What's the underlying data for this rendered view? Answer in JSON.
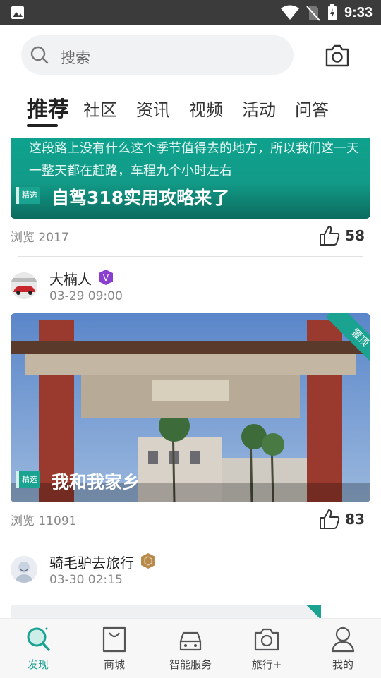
{
  "status_bar": {
    "time": "9:33"
  },
  "search": {
    "placeholder": "搜索"
  },
  "tabs": [
    {
      "label": "推荐",
      "active": true
    },
    {
      "label": "社区"
    },
    {
      "label": "资讯"
    },
    {
      "label": "视频"
    },
    {
      "label": "活动"
    },
    {
      "label": "问答"
    }
  ],
  "feed": [
    {
      "description": "这段路上没有什么这个季节值得去的地方，所以我们这一天一整天都在赶路，车程九个小时左右",
      "badge": "精选",
      "title": "自驾318实用攻略来了",
      "views": "浏览 2017",
      "likes": "58"
    },
    {
      "author": "大楠人",
      "date": "03-29 09:00",
      "pinned": "置顶",
      "badge": "精选",
      "title": "我和我家乡",
      "views": "浏览 11091",
      "likes": "83"
    },
    {
      "author": "骑毛驴去旅行",
      "date": "03-30 02:15"
    }
  ],
  "bottom_nav": [
    {
      "label": "发现",
      "icon": "discover-icon",
      "active": true
    },
    {
      "label": "商城",
      "icon": "shop-icon"
    },
    {
      "label": "智能服务",
      "icon": "car-service-icon"
    },
    {
      "label": "旅行+",
      "icon": "camera-icon"
    },
    {
      "label": "我的",
      "icon": "profile-icon"
    }
  ],
  "colors": {
    "accent": "#1aa390",
    "status_bar": "#3b3b3b"
  }
}
